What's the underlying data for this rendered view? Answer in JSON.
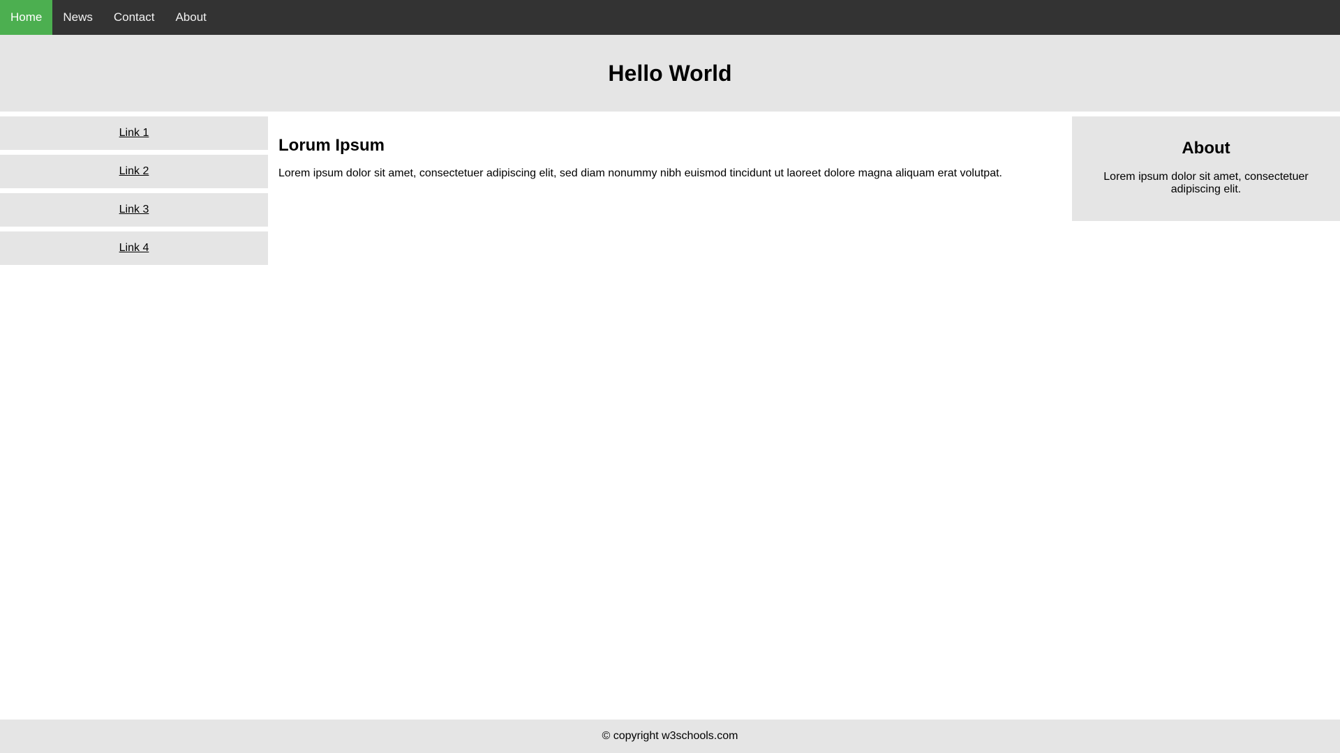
{
  "colors": {
    "nav_background": "#333333",
    "nav_active": "#4caf50",
    "panel_background": "#e5e5e5"
  },
  "topnav": {
    "items": [
      {
        "label": "Home",
        "active": true
      },
      {
        "label": "News",
        "active": false
      },
      {
        "label": "Contact",
        "active": false
      },
      {
        "label": "About",
        "active": false
      }
    ]
  },
  "header": {
    "title": "Hello World"
  },
  "sidebar": {
    "links": [
      {
        "label": "Link 1"
      },
      {
        "label": "Link 2"
      },
      {
        "label": "Link 3"
      },
      {
        "label": "Link 4"
      }
    ]
  },
  "main": {
    "heading": "Lorum Ipsum",
    "paragraph": "Lorem ipsum dolor sit amet, consectetuer adipiscing elit, sed diam nonummy nibh euismod tincidunt ut laoreet dolore magna aliquam erat volutpat."
  },
  "about": {
    "heading": "About",
    "text": "Lorem ipsum dolor sit amet, consectetuer adipiscing elit."
  },
  "footer": {
    "text": "© copyright w3schools.com"
  }
}
